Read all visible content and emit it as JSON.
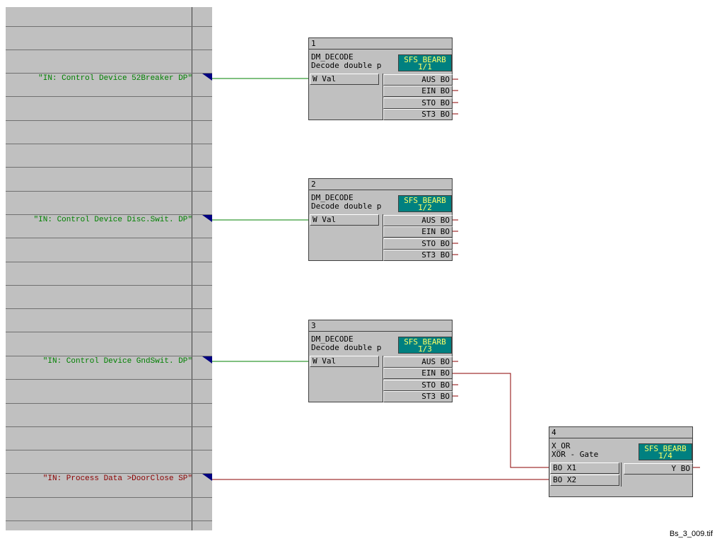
{
  "colors": {
    "panel": "#c0c0c0",
    "green_signal": "#008000",
    "red_signal": "#8b0000",
    "task_bg": "#008080",
    "task_text": "#ffff66"
  },
  "margin_signals": [
    {
      "label": "\"IN: Control Device 52Breaker DP\"",
      "color": "#008000"
    },
    {
      "label": "\"IN: Control Device Disc.Swit. DP\"",
      "color": "#008000"
    },
    {
      "label": "\"IN: Control Device GndSwit. DP\"",
      "color": "#008000"
    },
    {
      "label": "\"IN: Process Data >DoorClose SP\"",
      "color": "#8b0000"
    }
  ],
  "blocks": [
    {
      "number": "1",
      "type": "DM_DECODE",
      "description": "Decode double p",
      "task_line1": "SFS_BEARB",
      "task_line2": "1/1",
      "inputs": [
        "W  Val"
      ],
      "outputs": [
        "AUS BO",
        "EIN BO",
        "STO BO",
        "ST3 BO"
      ]
    },
    {
      "number": "2",
      "type": "DM_DECODE",
      "description": "Decode double p",
      "task_line1": "SFS_BEARB",
      "task_line2": "1/2",
      "inputs": [
        "W  Val"
      ],
      "outputs": [
        "AUS BO",
        "EIN BO",
        "STO BO",
        "ST3 BO"
      ]
    },
    {
      "number": "3",
      "type": "DM_DECODE",
      "description": "Decode double p",
      "task_line1": "SFS_BEARB",
      "task_line2": "1/3",
      "inputs": [
        "W  Val"
      ],
      "outputs": [
        "AUS BO",
        "EIN BO",
        "STO BO",
        "ST3 BO"
      ]
    },
    {
      "number": "4",
      "type": "X_OR",
      "description": "XOR - Gate",
      "task_line1": "SFS_BEARB",
      "task_line2": "1/4",
      "inputs": [
        "BO X1",
        "BO X2"
      ],
      "outputs": [
        "Y BO"
      ]
    }
  ],
  "caption": "Bs_3_009.tif"
}
